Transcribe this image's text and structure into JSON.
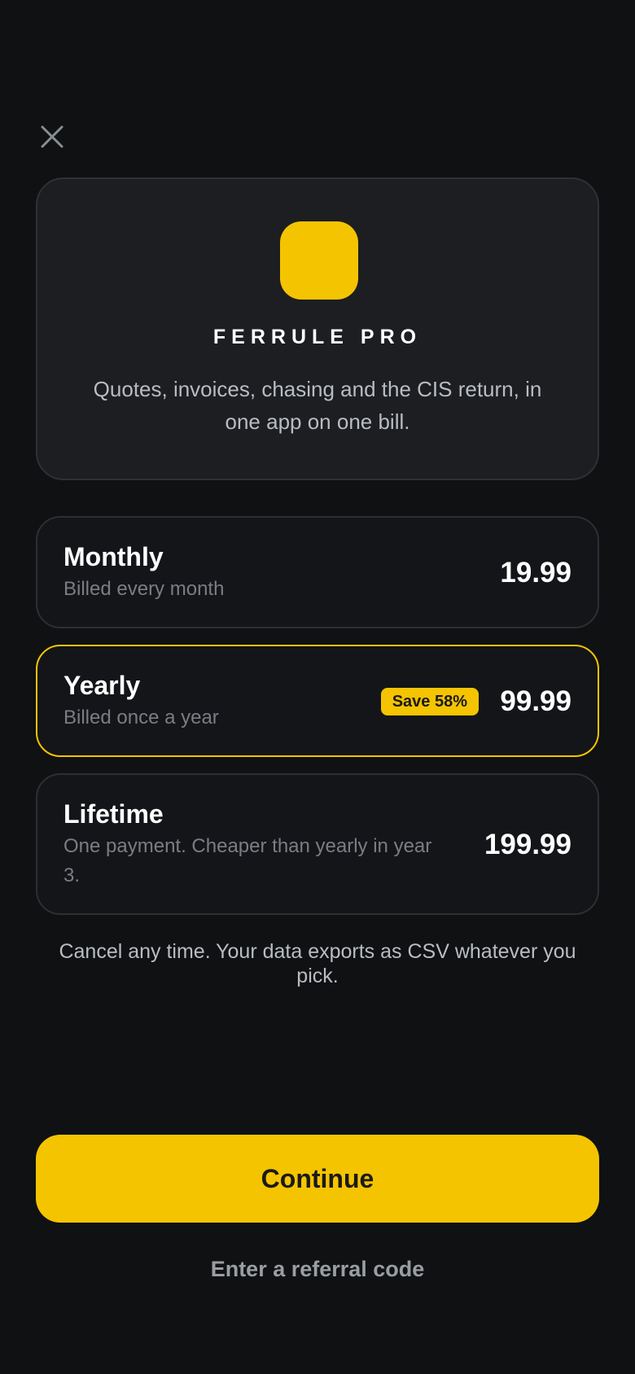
{
  "header": {
    "close_icon": "close-icon"
  },
  "hero": {
    "icon": "app-icon",
    "icon_color": "#f5c400",
    "title": "FERRULE PRO",
    "description": "Quotes, invoices, chasing and the CIS return, in one app on one bill."
  },
  "plans": [
    {
      "name": "Monthly",
      "subtitle": "Billed every month",
      "price": "19.99",
      "selected": false
    },
    {
      "name": "Yearly",
      "subtitle": "Billed once a year",
      "badge": "Save 58%",
      "price": "99.99",
      "selected": true
    },
    {
      "name": "Lifetime",
      "subtitle": "One payment. Cheaper than yearly in year 3.",
      "price": "199.99",
      "selected": false
    }
  ],
  "note": "Cancel any time. Your data exports as CSV whatever you pick.",
  "actions": {
    "continue_label": "Continue",
    "referral_label": "Enter a referral code"
  },
  "colors": {
    "accent": "#f5c400",
    "background": "#0f1113",
    "card": "#1c1e21"
  }
}
